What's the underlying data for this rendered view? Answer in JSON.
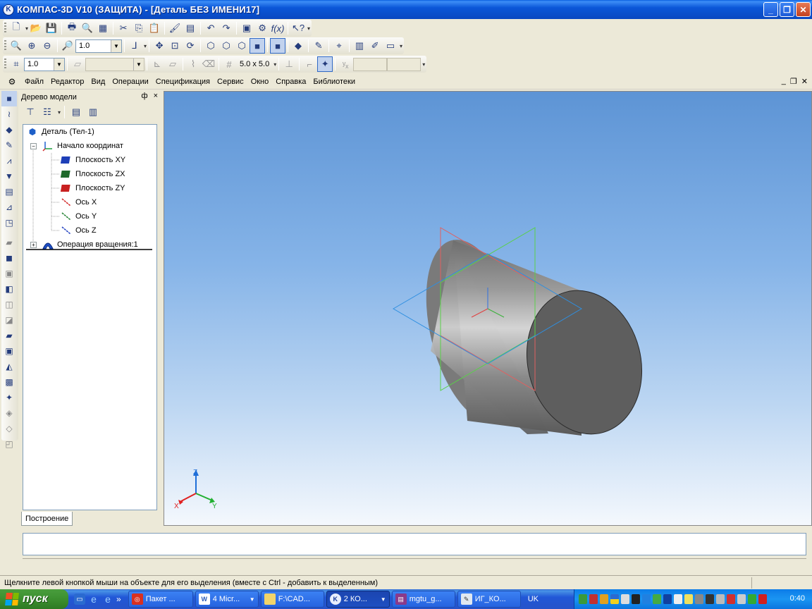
{
  "window": {
    "title": "КОМПАС-3D V10 (ЗАЩИТА) - [Деталь БЕЗ ИМЕНИ17]",
    "app_icon_letter": "K"
  },
  "toolbar_view": {
    "zoom_value": "1.0"
  },
  "toolbar_params": {
    "step_value": "1.0",
    "grid_size": "5.0 x 5.0"
  },
  "menu": {
    "items": [
      "Файл",
      "Редактор",
      "Вид",
      "Операции",
      "Спецификация",
      "Сервис",
      "Окно",
      "Справка",
      "Библиотеки"
    ]
  },
  "tree": {
    "title": "Дерево модели",
    "pin_glyph": "ф",
    "close_glyph": "×",
    "nodes": {
      "root": "Деталь (Тел-1)",
      "origin": "Начало координат",
      "plane_xy": "Плоскость XY",
      "plane_zx": "Плоскость ZX",
      "plane_zy": "Плоскость ZY",
      "axis_x": "Ось X",
      "axis_y": "Ось Y",
      "axis_z": "Ось Z",
      "revolve": "Операция вращения:1"
    },
    "tab_label": "Построение"
  },
  "viewport": {
    "triad": {
      "x": "X",
      "y": "Y",
      "z": "Z"
    },
    "colors": {
      "plane_xy": "#2f8fe0",
      "plane_zx": "#e06060",
      "plane_zy": "#5ad04a",
      "cylinder_side": "#8c8c8c",
      "cylinder_face": "#606060"
    }
  },
  "status": {
    "hint": "Щелкните левой кнопкой мыши на объекте для его выделения (вместе с Ctrl - добавить к выделенным)"
  },
  "taskbar": {
    "start_label": "пуск",
    "quick_launch_more": "»",
    "tasks": [
      {
        "label": "Пакет ...",
        "active": false
      },
      {
        "label": "4 Micr...",
        "active": false
      },
      {
        "label": "F:\\CAD...",
        "active": false
      },
      {
        "label": "2 КО...",
        "active": true
      },
      {
        "label": "mgtu_g...",
        "active": false
      },
      {
        "label": "ИГ_КО...",
        "active": false
      }
    ],
    "language": "UK",
    "clock": "0:40"
  }
}
